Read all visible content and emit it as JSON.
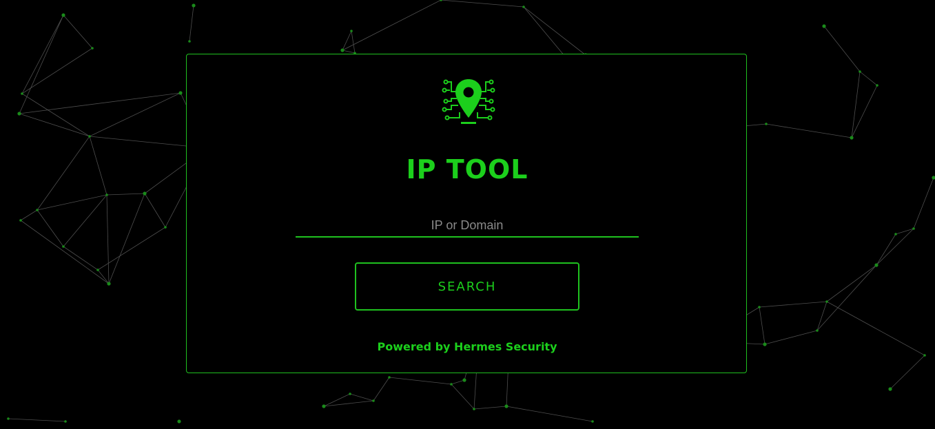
{
  "theme": {
    "accent": "#1ccf1c",
    "background": "#000000",
    "network_line": "#6a6a6a",
    "network_node": "#1a8a1a"
  },
  "logo": {
    "icon": "location-pin-circuit-icon"
  },
  "title": "IP TOOL",
  "search": {
    "placeholder": "IP or Domain",
    "value": ""
  },
  "search_button": {
    "label": "SEARCH"
  },
  "footer": {
    "text": "Powered by Hermes Security"
  }
}
